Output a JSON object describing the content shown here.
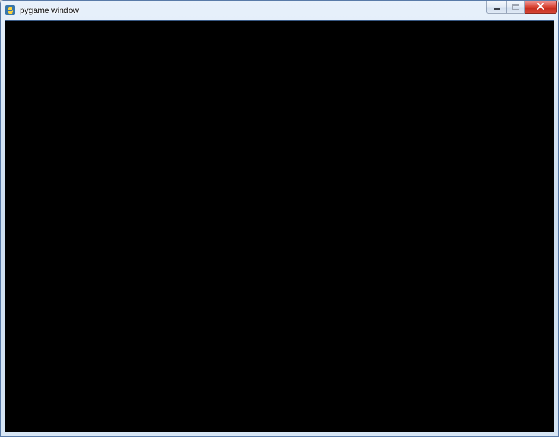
{
  "window": {
    "title": "pygame window"
  }
}
